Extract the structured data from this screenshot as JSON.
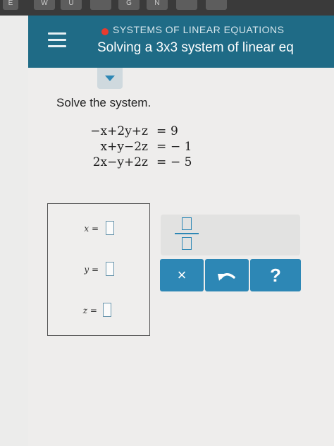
{
  "keyboard": {
    "keys": [
      "E",
      "W",
      "U",
      "",
      "G",
      "N"
    ]
  },
  "header": {
    "menu_icon": "hamburger-menu-icon",
    "topic_dot_color": "#e63b2e",
    "topic": "SYSTEMS OF LINEAR EQUATIONS",
    "title": "Solving a 3x3 system of linear eq"
  },
  "tab": {
    "icon": "caret-down-icon"
  },
  "problem": {
    "prompt": "Solve the system.",
    "equations": [
      {
        "lhs": "−x+2y+z",
        "sign": "=",
        "rhs": "9"
      },
      {
        "lhs": "x+y−2z",
        "sign": "=",
        "rhs": "− 1"
      },
      {
        "lhs": "2x−y+2z",
        "sign": "=",
        "rhs": "− 5"
      }
    ]
  },
  "answers": [
    {
      "label": "x =",
      "value": ""
    },
    {
      "label": "y =",
      "value": ""
    },
    {
      "label": "z =",
      "value": ""
    }
  ],
  "keypad": {
    "fraction_icon": "fraction-icon",
    "clear_label": "×",
    "undo_icon": "undo-icon",
    "help_label": "?",
    "accent_color": "#2d87b5"
  }
}
